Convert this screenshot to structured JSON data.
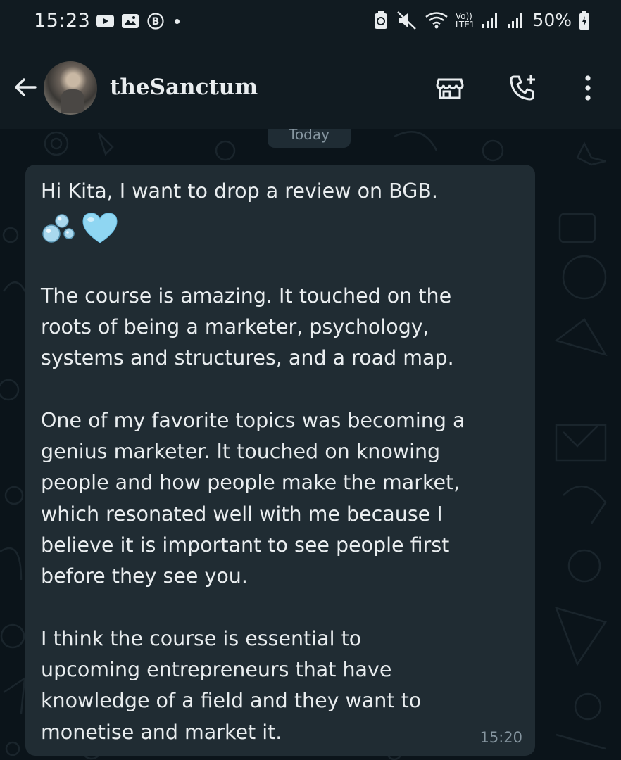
{
  "status_bar": {
    "time": "15:23",
    "volte_top": "Vo))",
    "volte_bottom": "LTE1",
    "battery": "50%",
    "icons": [
      "youtube-icon",
      "gallery-icon",
      "b-badge-icon",
      "battery-saver-icon",
      "mute-icon",
      "wifi-icon",
      "signal-icon",
      "signal-icon",
      "battery-icon"
    ]
  },
  "header": {
    "contact_name": "theSanctum",
    "icons": [
      "back-arrow-icon",
      "store-icon",
      "add-call-icon",
      "more-options-icon"
    ]
  },
  "chat": {
    "date_chip": "Today",
    "message": {
      "lines": [
        "Hi Kita, I want to drop a review on BGB.",
        "",
        "",
        "The course is amazing. It touched on the",
        "roots of being a marketer, psychology,",
        "systems and structures, and a road map.",
        "",
        "One of my favorite topics was becoming a",
        "genius marketer. It touched on knowing",
        "people and how people make the market,",
        "which resonated well with me because I",
        "believe it is important to see people first",
        "before they see you.",
        "",
        "I think the course is essential to",
        "upcoming entrepreneurs that have",
        "knowledge of a field and they want to",
        "monetise and market it."
      ],
      "emojis": [
        "bubbles-emoji",
        "light-blue-heart-emoji"
      ],
      "time": "15:20"
    }
  },
  "colors": {
    "background": "#0b141a",
    "header": "#111b21",
    "bubble": "#202c33",
    "text": "#e9edef",
    "muted": "#8696a0",
    "heart": "#8fd6f2"
  }
}
